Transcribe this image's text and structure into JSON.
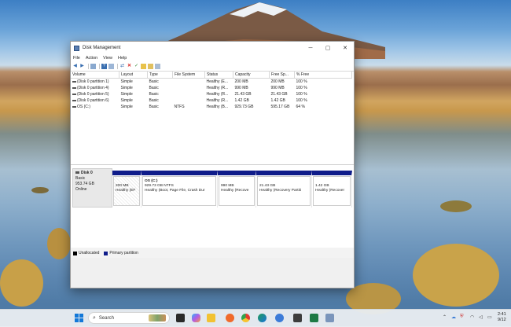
{
  "window": {
    "title": "Disk Management"
  },
  "menu": [
    "File",
    "Action",
    "View",
    "Help"
  ],
  "colors": {
    "primary_partition": "#0f1c8a",
    "unallocated": "#000000"
  },
  "volume_table": {
    "columns": [
      "Volume",
      "Layout",
      "Type",
      "File System",
      "Status",
      "Capacity",
      "Free Sp...",
      "% Free"
    ],
    "rows": [
      [
        "(Disk 0 partition 1)",
        "Simple",
        "Basic",
        "",
        "Healthy (E...",
        "200 MB",
        "200 MB",
        "100 %"
      ],
      [
        "(Disk 0 partition 4)",
        "Simple",
        "Basic",
        "",
        "Healthy (R...",
        "990 MB",
        "990 MB",
        "100 %"
      ],
      [
        "(Disk 0 partition 5)",
        "Simple",
        "Basic",
        "",
        "Healthy (R...",
        "21.43 GB",
        "21.43 GB",
        "100 %"
      ],
      [
        "(Disk 0 partition 6)",
        "Simple",
        "Basic",
        "",
        "Healthy (R...",
        "1.42 GB",
        "1.42 GB",
        "100 %"
      ],
      [
        "OS (C:)",
        "Simple",
        "Basic",
        "NTFS",
        "Healthy (B...",
        "929.73 GB",
        "595.17 GB",
        "64 %"
      ]
    ]
  },
  "disk": {
    "name": "Disk 0",
    "type": "Basic",
    "size": "953.74 GB",
    "status": "Online"
  },
  "partitions": [
    {
      "title": "",
      "size": "200 MB",
      "status": "Healthy (EF"
    },
    {
      "title": "OS  (C:)",
      "size": "929.73 GB NTFS",
      "status": "Healthy (Boot, Page File, Crash Dur"
    },
    {
      "title": "",
      "size": "990 MB",
      "status": "Healthy (Recove"
    },
    {
      "title": "",
      "size": "21.43 GB",
      "status": "Healthy (Recovery Partiti"
    },
    {
      "title": "",
      "size": "1.42 GB",
      "status": "Healthy (Recover"
    }
  ],
  "legend": {
    "unallocated": "Unallocated",
    "primary": "Primary partition"
  },
  "taskbar": {
    "search_placeholder": "Search",
    "time": "2:41",
    "date": "9/12"
  }
}
